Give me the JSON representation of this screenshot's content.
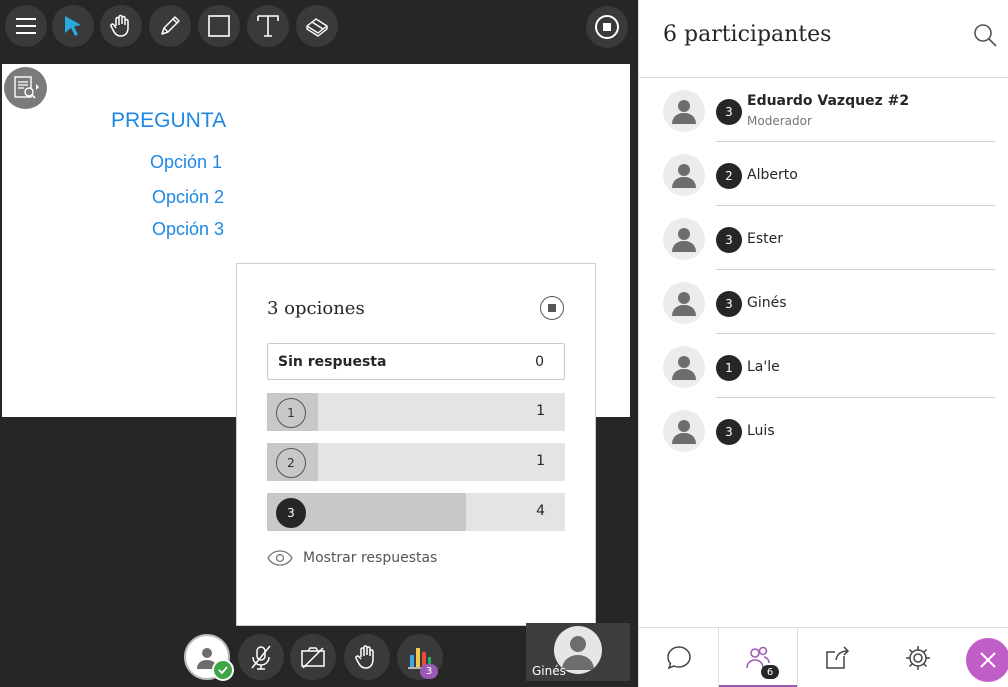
{
  "toolbar": {
    "tools": [
      "menu",
      "select",
      "pan",
      "pencil",
      "shape",
      "text",
      "eraser"
    ],
    "icons": [
      "menu-icon",
      "pointer-icon",
      "hand-icon",
      "pencil-icon",
      "square-icon",
      "text-icon",
      "eraser-icon"
    ]
  },
  "whiteboard": {
    "heading": "PREGUNTA",
    "options": [
      "Opción 1",
      "Opción 2",
      "Opción 3"
    ],
    "text_color": "#1e88e5"
  },
  "poll": {
    "title": "3 opciones",
    "no_response_label": "Sin respuesta",
    "no_response_count": "0",
    "total": 6,
    "options": [
      {
        "number": "1",
        "count": "1",
        "fraction": 0.1667,
        "selected": false
      },
      {
        "number": "2",
        "count": "1",
        "fraction": 0.1667,
        "selected": false
      },
      {
        "number": "3",
        "count": "4",
        "fraction": 0.6667,
        "selected": true
      }
    ],
    "show_responses_label": "Mostrar respuestas"
  },
  "controls": {
    "poll_badge": "3",
    "self_name": "Ginés",
    "status": "check"
  },
  "panel": {
    "title": "6 participantes",
    "participants": [
      {
        "group": "3",
        "name": "Eduardo Vazquez #2",
        "role": "Moderador"
      },
      {
        "group": "2",
        "name": "Alberto",
        "role": ""
      },
      {
        "group": "3",
        "name": "Ester",
        "role": ""
      },
      {
        "group": "3",
        "name": "Ginés",
        "role": ""
      },
      {
        "group": "1",
        "name": "La'le",
        "role": ""
      },
      {
        "group": "3",
        "name": "Luis",
        "role": ""
      }
    ]
  },
  "tabs": {
    "people_badge": "6",
    "accent": "#9b59b6"
  }
}
